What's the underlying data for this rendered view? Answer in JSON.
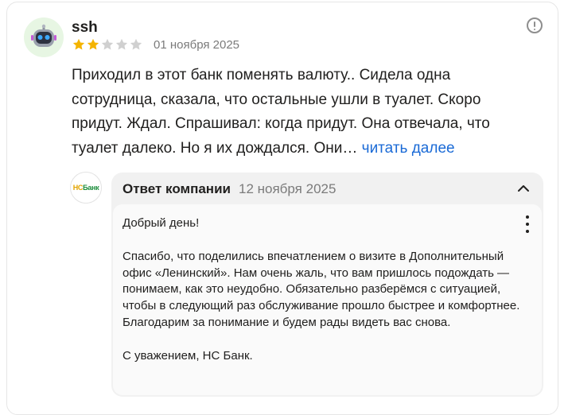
{
  "review": {
    "author": "ssh",
    "rating": 2,
    "rating_max": 5,
    "date": "01 ноября 2025",
    "text": "Приходил в этот банк поменять валюту.. Сидела одна сотрудница, сказала, что остальные ушли в туалет. Скоро придут. Ждал. Спрашивал: когда придут. Она отвечала, что туалет далеко. Но я их дождался. Они…",
    "read_more": "читать далее",
    "icons": {
      "avatar": "robot-avatar-icon",
      "menu": "info-icon"
    },
    "colors": {
      "star_filled": "#f4b400",
      "star_empty": "#d0d0d0",
      "link": "#1a6ad6"
    }
  },
  "reply": {
    "logo_prefix": "НС",
    "logo_suffix": "Банк",
    "title": "Ответ компании",
    "date": "12 ноября 2025",
    "greeting": "Добрый день!",
    "paragraph": "Спасибо, что поделились впечатлением о визите в Дополнительный офис «Ленинский». Нам очень жаль, что вам пришлось подождать — понимаем, как это неудобно. Обязательно разберёмся с ситуацией, чтобы в следующий раз обслуживание прошло быстрее и комфортнее. Благодарим за понимание и будем рады видеть вас снова.",
    "signature": "С уважением, НС Банк.",
    "icons": {
      "collapse": "chevron-up-icon",
      "more": "more-vertical-icon"
    }
  }
}
